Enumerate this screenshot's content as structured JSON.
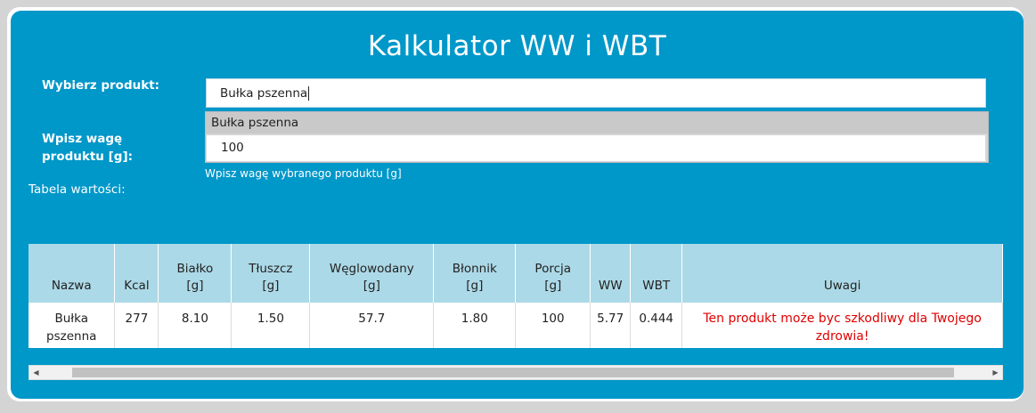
{
  "title": "Kalkulator WW i WBT",
  "form": {
    "product_label": "Wybierz produkt:",
    "product_value": "Bułka pszenna",
    "dropdown_option": "Bułka pszenna",
    "weight_label": "Wpisz wagę produktu [g]:",
    "weight_value": "100",
    "weight_hint": "Wpisz wagę wybranego produktu [g]"
  },
  "table_label": "Tabela wartości:",
  "table": {
    "headers": [
      {
        "line1": "",
        "line2": "Nazwa"
      },
      {
        "line1": "",
        "line2": "Kcal"
      },
      {
        "line1": "Białko",
        "line2": "[g]"
      },
      {
        "line1": "Tłuszcz",
        "line2": "[g]"
      },
      {
        "line1": "Węglowodany",
        "line2": "[g]"
      },
      {
        "line1": "Błonnik",
        "line2": "[g]"
      },
      {
        "line1": "Porcja",
        "line2": "[g]"
      },
      {
        "line1": "",
        "line2": "WW"
      },
      {
        "line1": "",
        "line2": "WBT"
      },
      {
        "line1": "",
        "line2": "Uwagi"
      }
    ],
    "row": {
      "nazwa": "Bułka pszenna",
      "kcal": "277",
      "bialko": "8.10",
      "tluszcz": "1.50",
      "weglowodany": "57.7",
      "blonnik": "1.80",
      "porcja": "100",
      "ww": "5.77",
      "wbt": "0.444",
      "uwagi": "Ten produkt może byc szkodliwy dla Twojego zdrowia!"
    }
  },
  "icons": {
    "scroll_left": "arrow-left-icon",
    "scroll_right": "arrow-right-icon"
  },
  "colors": {
    "panel": "#0097c9",
    "table_header": "#acd9e7",
    "warning": "#e00000"
  }
}
